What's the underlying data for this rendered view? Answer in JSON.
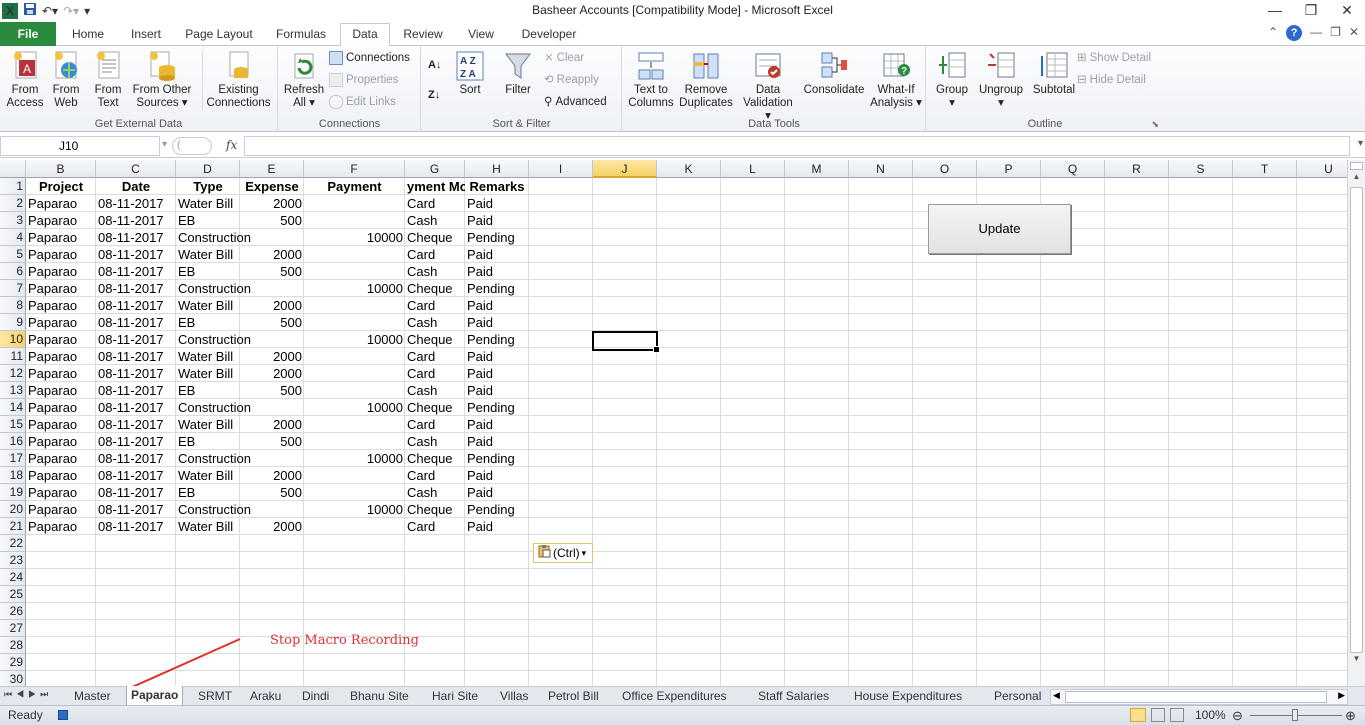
{
  "window": {
    "title": "Basheer Accounts  [Compatibility Mode]  -  Microsoft Excel"
  },
  "tabs": [
    "File",
    "Home",
    "Insert",
    "Page Layout",
    "Formulas",
    "Data",
    "Review",
    "View",
    "Developer"
  ],
  "ribbon": {
    "get_external": {
      "label": "Get External Data",
      "buttons": [
        {
          "line1": "From",
          "line2": "Access"
        },
        {
          "line1": "From",
          "line2": "Web"
        },
        {
          "line1": "From",
          "line2": "Text"
        },
        {
          "line1": "From Other",
          "line2": "Sources"
        },
        {
          "line1": "Existing",
          "line2": "Connections"
        }
      ]
    },
    "connections": {
      "label": "Connections",
      "refresh": {
        "line1": "Refresh",
        "line2": "All"
      },
      "connections": "Connections",
      "properties": "Properties",
      "edit_links": "Edit Links"
    },
    "sort_filter": {
      "label": "Sort & Filter",
      "sort": "Sort",
      "filter": "Filter",
      "clear": "Clear",
      "reapply": "Reapply",
      "advanced": "Advanced"
    },
    "data_tools": {
      "label": "Data Tools",
      "buttons": [
        {
          "line1": "Text to",
          "line2": "Columns"
        },
        {
          "line1": "Remove",
          "line2": "Duplicates"
        },
        {
          "line1": "Data",
          "line2": "Validation"
        },
        {
          "line1": "Consolidate",
          "line2": ""
        },
        {
          "line1": "What-If",
          "line2": "Analysis"
        }
      ]
    },
    "outline": {
      "label": "Outline",
      "group": "Group",
      "ungroup": "Ungroup",
      "subtotal": "Subtotal",
      "show_detail": "Show Detail",
      "hide_detail": "Hide Detail"
    }
  },
  "formula_bar": {
    "name_box": "J10",
    "fx": "fx",
    "formula": ""
  },
  "columns": [
    "B",
    "C",
    "D",
    "E",
    "F",
    "G",
    "H",
    "I",
    "J",
    "K",
    "L",
    "M",
    "N",
    "O",
    "P",
    "Q",
    "R",
    "S",
    "T",
    "U"
  ],
  "selected_column": "J",
  "selected_row": "10",
  "header_row": {
    "B": "Project",
    "C": "Date",
    "D": "Type",
    "E": "Expense",
    "F": "Payment",
    "G": "yment Mo",
    "H": "Remarks"
  },
  "rows": [
    [
      "Paparao",
      "08-11-2017",
      "Water Bill",
      "2000",
      "",
      "Card",
      "Paid"
    ],
    [
      "Paparao",
      "08-11-2017",
      "EB",
      "500",
      "",
      "Cash",
      "Paid"
    ],
    [
      "Paparao",
      "08-11-2017",
      "Construction",
      "",
      "10000",
      "Cheque",
      "Pending"
    ],
    [
      "Paparao",
      "08-11-2017",
      "Water Bill",
      "2000",
      "",
      "Card",
      "Paid"
    ],
    [
      "Paparao",
      "08-11-2017",
      "EB",
      "500",
      "",
      "Cash",
      "Paid"
    ],
    [
      "Paparao",
      "08-11-2017",
      "Construction",
      "",
      "10000",
      "Cheque",
      "Pending"
    ],
    [
      "Paparao",
      "08-11-2017",
      "Water Bill",
      "2000",
      "",
      "Card",
      "Paid"
    ],
    [
      "Paparao",
      "08-11-2017",
      "EB",
      "500",
      "",
      "Cash",
      "Paid"
    ],
    [
      "Paparao",
      "08-11-2017",
      "Construction",
      "",
      "10000",
      "Cheque",
      "Pending"
    ],
    [
      "Paparao",
      "08-11-2017",
      "Water Bill",
      "2000",
      "",
      "Card",
      "Paid"
    ],
    [
      "Paparao",
      "08-11-2017",
      "Water Bill",
      "2000",
      "",
      "Card",
      "Paid"
    ],
    [
      "Paparao",
      "08-11-2017",
      "EB",
      "500",
      "",
      "Cash",
      "Paid"
    ],
    [
      "Paparao",
      "08-11-2017",
      "Construction",
      "",
      "10000",
      "Cheque",
      "Pending"
    ],
    [
      "Paparao",
      "08-11-2017",
      "Water Bill",
      "2000",
      "",
      "Card",
      "Paid"
    ],
    [
      "Paparao",
      "08-11-2017",
      "EB",
      "500",
      "",
      "Cash",
      "Paid"
    ],
    [
      "Paparao",
      "08-11-2017",
      "Construction",
      "",
      "10000",
      "Cheque",
      "Pending"
    ],
    [
      "Paparao",
      "08-11-2017",
      "Water Bill",
      "2000",
      "",
      "Card",
      "Paid"
    ],
    [
      "Paparao",
      "08-11-2017",
      "EB",
      "500",
      "",
      "Cash",
      "Paid"
    ],
    [
      "Paparao",
      "08-11-2017",
      "Construction",
      "",
      "10000",
      "Cheque",
      "Pending"
    ],
    [
      "Paparao",
      "08-11-2017",
      "Water Bill",
      "2000",
      "",
      "Card",
      "Paid"
    ]
  ],
  "row_numbers": [
    "1",
    "2",
    "3",
    "4",
    "5",
    "6",
    "7",
    "8",
    "9",
    "10",
    "11",
    "12",
    "13",
    "14",
    "15",
    "16",
    "17",
    "18",
    "19",
    "20",
    "21",
    "22",
    "23",
    "24",
    "25",
    "26",
    "27",
    "28",
    "29",
    "30"
  ],
  "update_button": "Update",
  "paste_options": "(Ctrl)",
  "annotation": "Stop Macro Recording",
  "sheet_tabs": [
    "Master",
    "Paparao",
    "SRMT",
    "Araku",
    "Dindi",
    "Bhanu Site",
    "Hari Site",
    "Villas",
    "Petrol Bill",
    "Office Expenditures",
    "Staff Salaries",
    "House Expenditures",
    "Personal"
  ],
  "active_sheet": "Paparao",
  "status": {
    "ready": "Ready",
    "zoom": "100%"
  },
  "colors": {
    "file_tab": "#2a8a3e",
    "selection_header": "#f7d267",
    "annotation": "#e23030"
  }
}
